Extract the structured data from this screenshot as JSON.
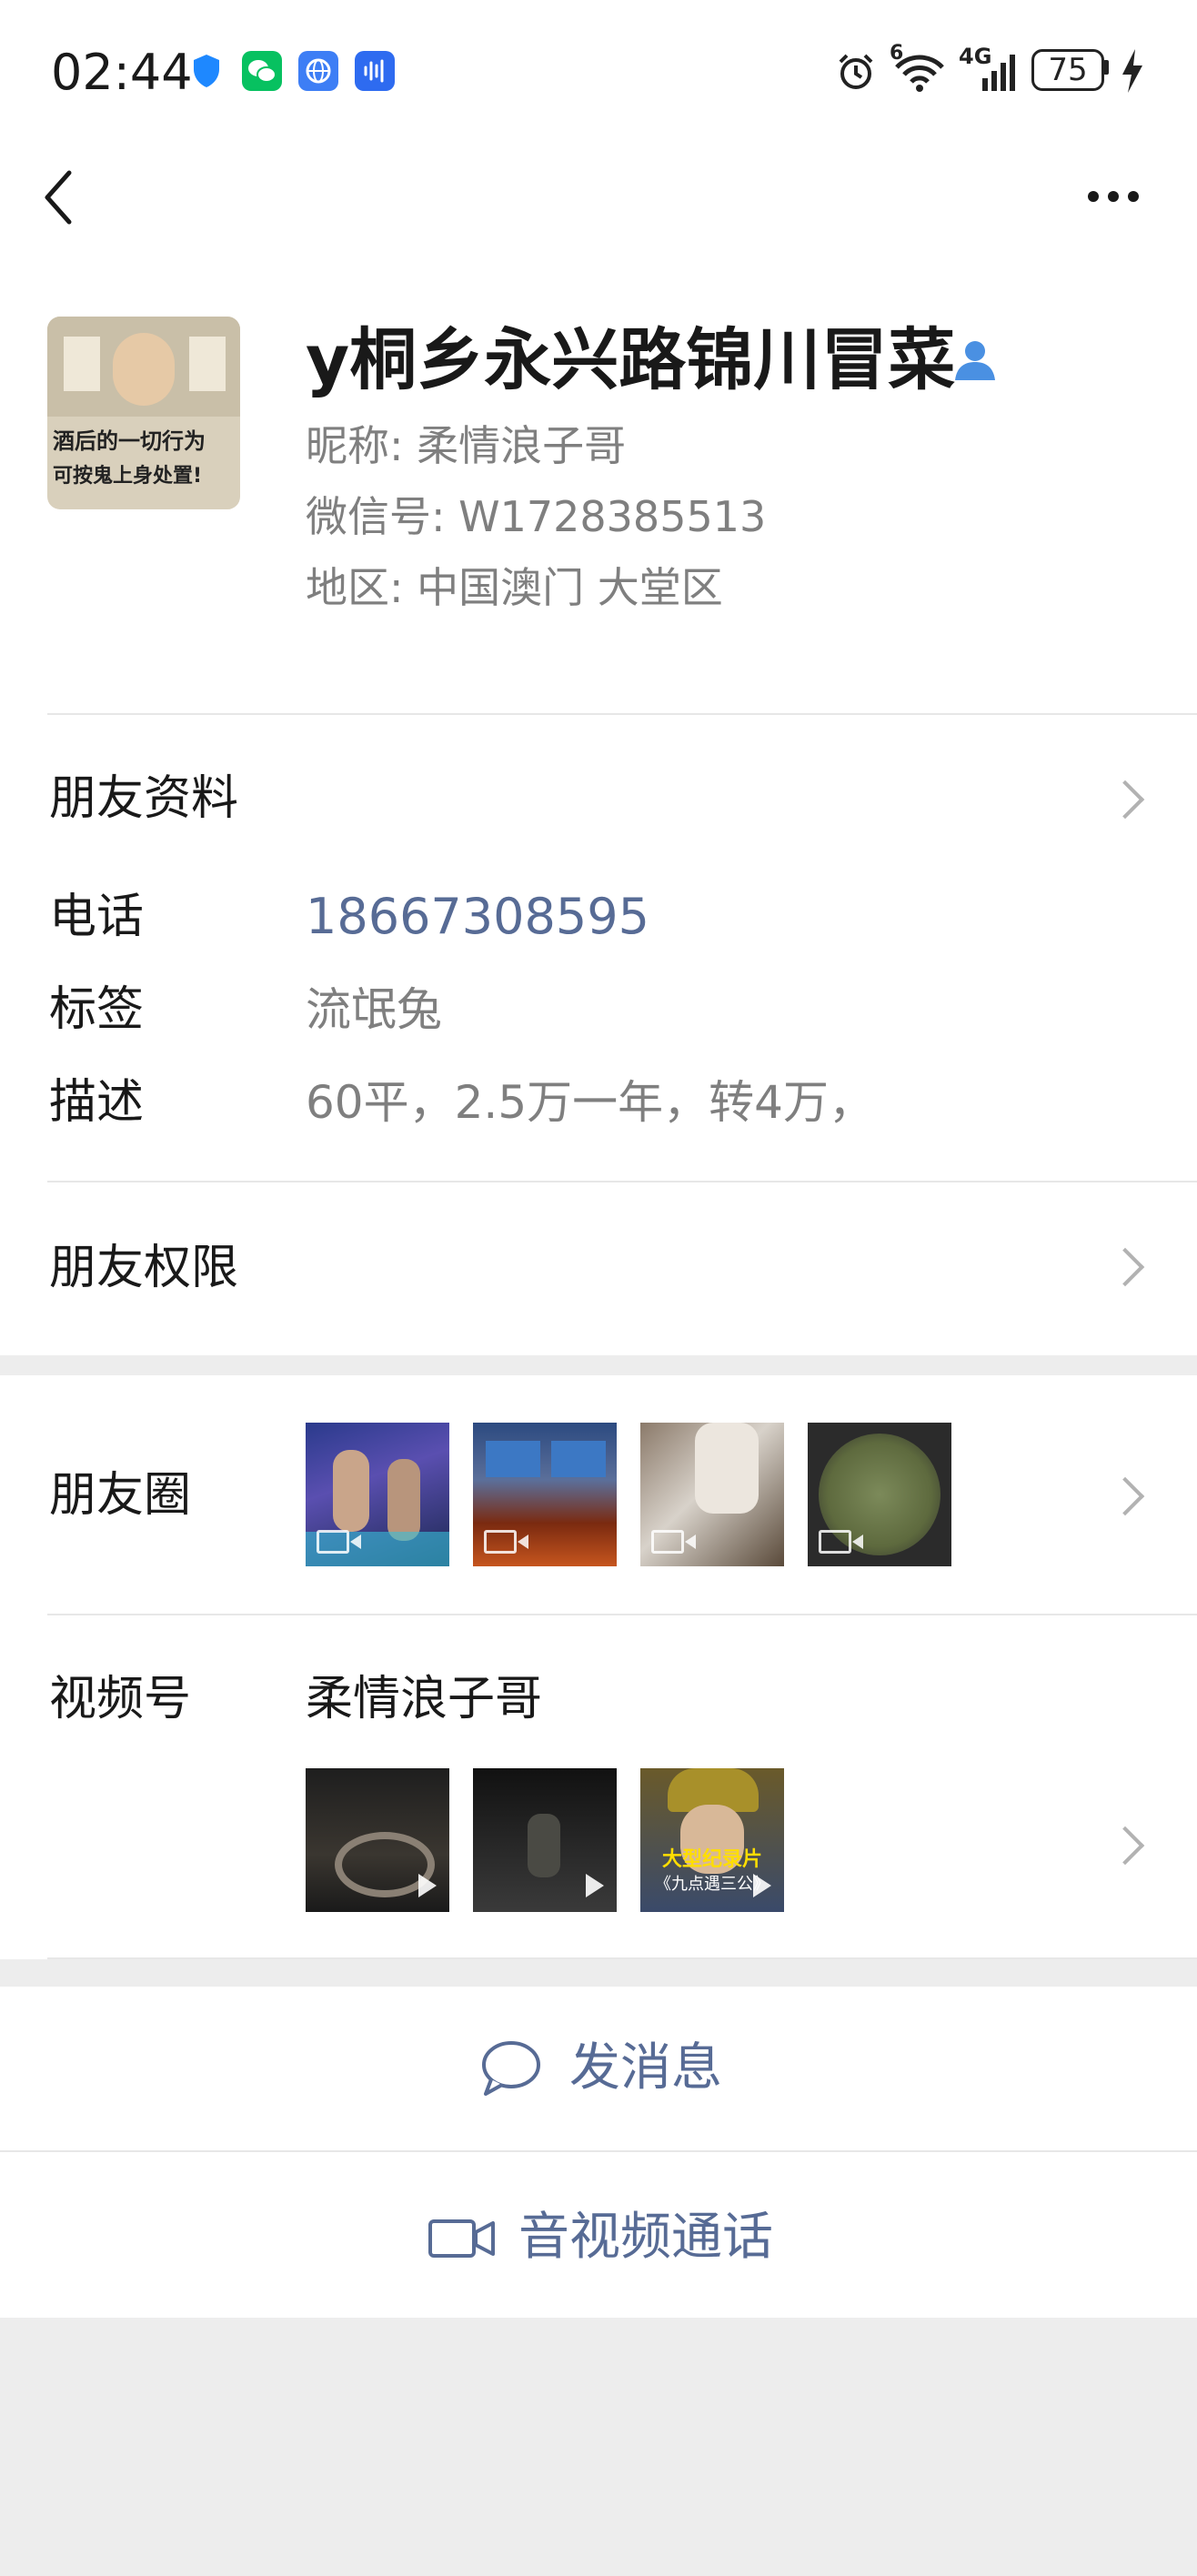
{
  "status_bar": {
    "time": "02:44",
    "battery": "75",
    "network": "4G",
    "wifi_badge": "6",
    "icons": [
      "shield-icon",
      "wechat-icon",
      "browser-icon",
      "voice-icon",
      "alarm-icon",
      "wifi-icon",
      "signal-icon",
      "battery-icon",
      "charging-icon"
    ]
  },
  "nav": {
    "back_icon": "chevron-left-icon",
    "more_icon": "more-dots-icon"
  },
  "profile": {
    "display_name": "y桐乡永兴路锦川冒菜",
    "nickname": "昵称:  柔情浪子哥",
    "wechat_id": "微信号:  W1728385513",
    "region": "地区:  中国澳门  大堂区",
    "avatar_text_1": "酒后的一切行为",
    "avatar_text_2": "可按鬼上身处置!",
    "gender_icon": "person-icon"
  },
  "friend_info": {
    "title": "朋友资料",
    "phone_label": "电话",
    "phone_value": "18667308595",
    "tag_label": "标签",
    "tag_value": "流氓兔",
    "desc_label": "描述",
    "desc_value": "60平，2.5万一年，转4万，"
  },
  "permissions": {
    "title": "朋友权限"
  },
  "moments": {
    "title": "朋友圈"
  },
  "channels": {
    "title": "视频号",
    "name": "柔情浪子哥",
    "thumb_caption_1": "大型纪录片",
    "thumb_caption_2": "《九点遇三公》"
  },
  "actions": {
    "message": "发消息",
    "call": "音视频通话"
  },
  "colors": {
    "link": "#576b95",
    "background": "#ededed",
    "divider": "#e7e7e7"
  }
}
